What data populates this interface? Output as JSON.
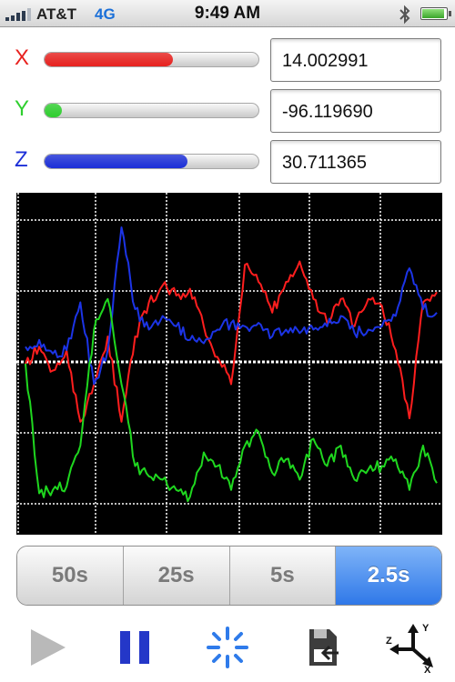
{
  "status_bar": {
    "carrier": "AT&T",
    "network": "4G",
    "time": "9:49 AM",
    "icons": [
      "signal-icon",
      "bluetooth-icon",
      "battery-icon"
    ]
  },
  "axes": [
    {
      "label": "X",
      "value": "14.002991",
      "color": "#e8221f",
      "fill_fraction": 0.6
    },
    {
      "label": "Y",
      "value": "-96.119690",
      "color": "#2fcf2f",
      "fill_fraction": 0.08
    },
    {
      "label": "Z",
      "value": "30.711365",
      "color": "#1c2fd8",
      "fill_fraction": 0.67
    }
  ],
  "chart_data": {
    "type": "line",
    "xlabel": "",
    "ylabel": "",
    "grid": true,
    "x": [
      0,
      2,
      4,
      6,
      8,
      10,
      12,
      14,
      16,
      18,
      20,
      22,
      24,
      26,
      28,
      30,
      32,
      34,
      36,
      38,
      40,
      42,
      44,
      46,
      48,
      50,
      52,
      54,
      56,
      58,
      60
    ],
    "series": [
      {
        "color": "#ff1e1e",
        "values": [
          0.0,
          0.25,
          -0.1,
          0.2,
          -0.85,
          -0.3,
          0.4,
          -0.85,
          0.4,
          0.9,
          1.15,
          1.0,
          1.1,
          0.55,
          0.1,
          -0.3,
          1.45,
          1.2,
          0.75,
          1.2,
          1.5,
          0.95,
          0.6,
          0.95,
          0.55,
          0.95,
          0.85,
          0.2,
          -0.8,
          0.9,
          1.05
        ]
      },
      {
        "color": "#1c34e6",
        "values": [
          0.25,
          0.35,
          0.15,
          0.2,
          0.9,
          -0.3,
          0.2,
          2.0,
          0.8,
          0.5,
          0.7,
          0.55,
          0.35,
          0.3,
          0.5,
          0.6,
          0.55,
          0.6,
          0.4,
          0.5,
          0.45,
          0.5,
          0.55,
          0.7,
          0.45,
          0.5,
          0.55,
          0.7,
          1.4,
          0.8,
          0.75
        ]
      },
      {
        "color": "#1fd71f",
        "values": [
          0.0,
          -1.9,
          -1.85,
          -1.8,
          -1.2,
          0.5,
          0.95,
          -0.3,
          -1.5,
          -1.65,
          -1.7,
          -1.85,
          -1.95,
          -1.3,
          -1.5,
          -1.85,
          -1.2,
          -1.0,
          -1.6,
          -1.4,
          -1.7,
          -1.1,
          -1.5,
          -1.2,
          -1.7,
          -1.55,
          -1.5,
          -1.4,
          -1.85,
          -1.2,
          -1.75
        ]
      }
    ]
  },
  "time_scale": {
    "options": [
      "50s",
      "25s",
      "5s",
      "2.5s"
    ],
    "selected": "2.5s"
  },
  "toolbar": {
    "buttons": [
      "play-icon",
      "pause-icon",
      "calibrate-icon",
      "export-icon",
      "axes-orientation-icon"
    ],
    "orientation_labels": {
      "y": "Y",
      "z": "Z",
      "x": "X"
    }
  },
  "colors": {
    "selected_segment": "#2f78e8",
    "chart_background": "#000000",
    "grid": "#ffffff"
  }
}
